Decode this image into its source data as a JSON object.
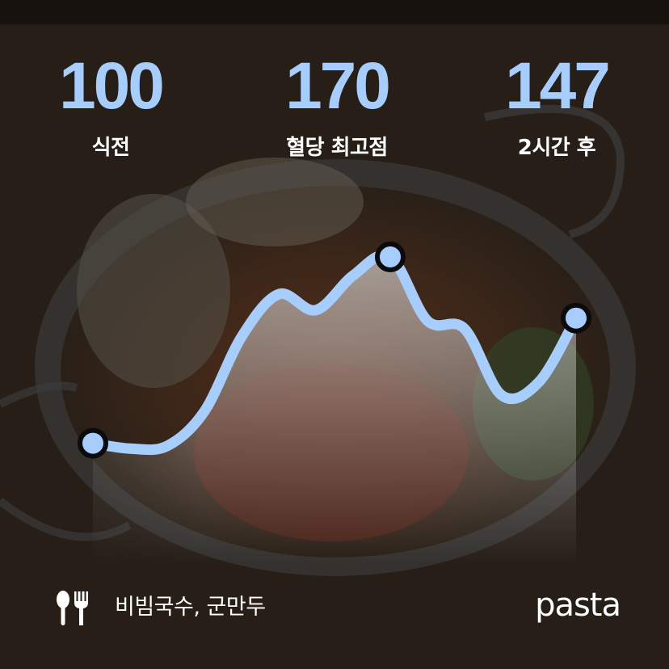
{
  "colors": {
    "accent": "#a7cdfd",
    "text": "#ffffff",
    "point_outline": "#0b0b0b"
  },
  "stats": [
    {
      "value": "100",
      "label": "식전"
    },
    {
      "value": "170",
      "label": "혈당 최고점"
    },
    {
      "value": "147",
      "label": "2시간 후"
    }
  ],
  "chart_data": {
    "type": "line",
    "title": "",
    "xlabel": "",
    "ylabel": "",
    "grid": false,
    "series": [
      {
        "values": [
          100,
          98,
          99,
          112,
          140,
          156,
          150,
          163,
          170,
          146,
          143,
          118,
          123,
          147
        ]
      }
    ],
    "highlighted_points": [
      {
        "index": 0,
        "value": 100
      },
      {
        "index": 8,
        "value": 170
      },
      {
        "index": 13,
        "value": 147
      }
    ],
    "ylim": [
      85,
      180
    ]
  },
  "footer": {
    "icon": "fork-knife-icon",
    "meal": "비빔국수, 군만두",
    "brand": "pasta"
  }
}
